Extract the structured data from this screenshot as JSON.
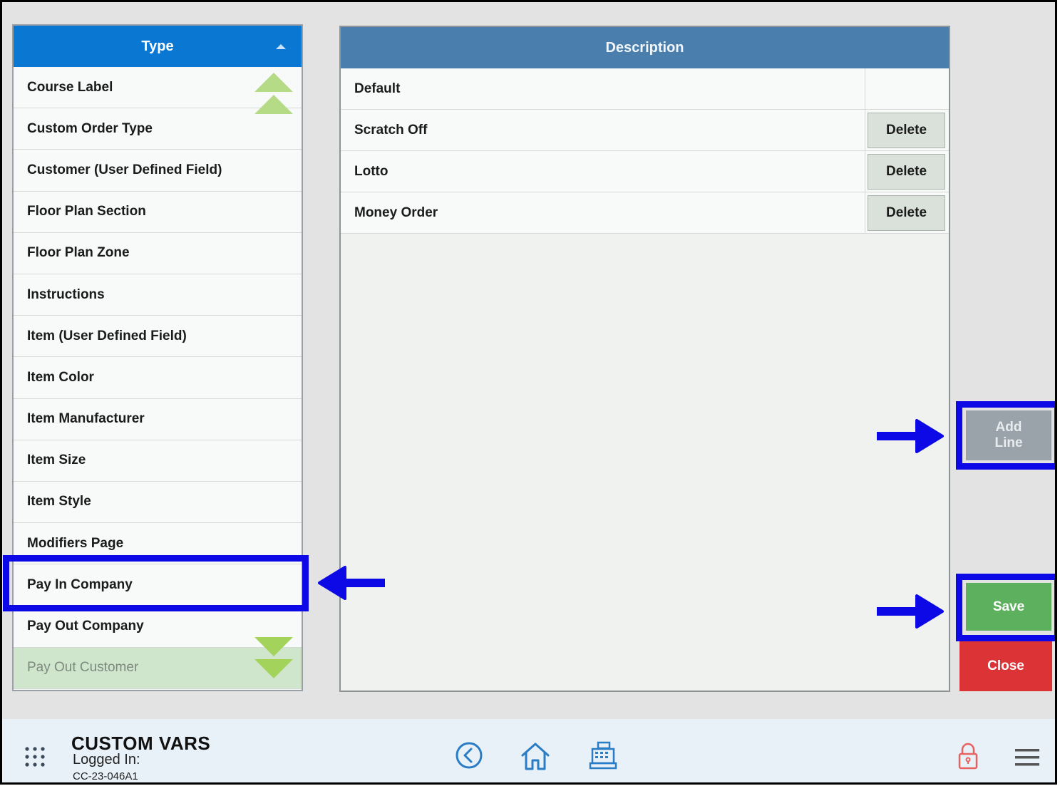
{
  "type_panel": {
    "header": "Type",
    "items": [
      {
        "label": "Course Label"
      },
      {
        "label": "Custom Order Type"
      },
      {
        "label": "Customer (User Defined Field)"
      },
      {
        "label": "Floor Plan Section"
      },
      {
        "label": "Floor Plan Zone"
      },
      {
        "label": "Instructions"
      },
      {
        "label": "Item (User Defined Field)"
      },
      {
        "label": "Item Color"
      },
      {
        "label": "Item Manufacturer"
      },
      {
        "label": "Item Size"
      },
      {
        "label": "Item Style"
      },
      {
        "label": "Modifiers Page"
      },
      {
        "label": "Pay In Company"
      },
      {
        "label": "Pay Out Company"
      },
      {
        "label": "Pay Out Customer"
      }
    ]
  },
  "description_panel": {
    "header": "Description",
    "rows": [
      {
        "text": "Default"
      },
      {
        "text": "Scratch Off",
        "delete_label": "Delete"
      },
      {
        "text": "Lotto",
        "delete_label": "Delete"
      },
      {
        "text": "Money Order",
        "delete_label": "Delete"
      }
    ]
  },
  "actions": {
    "add_line_label_1": "Add",
    "add_line_label_2": "Line",
    "save_label": "Save",
    "close_label": "Close"
  },
  "footer": {
    "app_title": "CUSTOM VARS",
    "logged_in_label": "Logged In:",
    "station_id": "CC-23-046A1"
  },
  "colors": {
    "header_blue": "#0a78d3",
    "description_header": "#4a7fad",
    "save_green": "#5db15e",
    "close_red": "#db3336",
    "annotation_blue": "#0c08e6"
  },
  "icons": [
    "sort-asc-icon",
    "scroll-up-icon",
    "scroll-down-icon",
    "arrow-right-icon",
    "arrow-left-icon",
    "grid-menu-icon",
    "back-icon",
    "home-icon",
    "cash-register-icon",
    "lock-icon",
    "hamburger-menu-icon"
  ]
}
